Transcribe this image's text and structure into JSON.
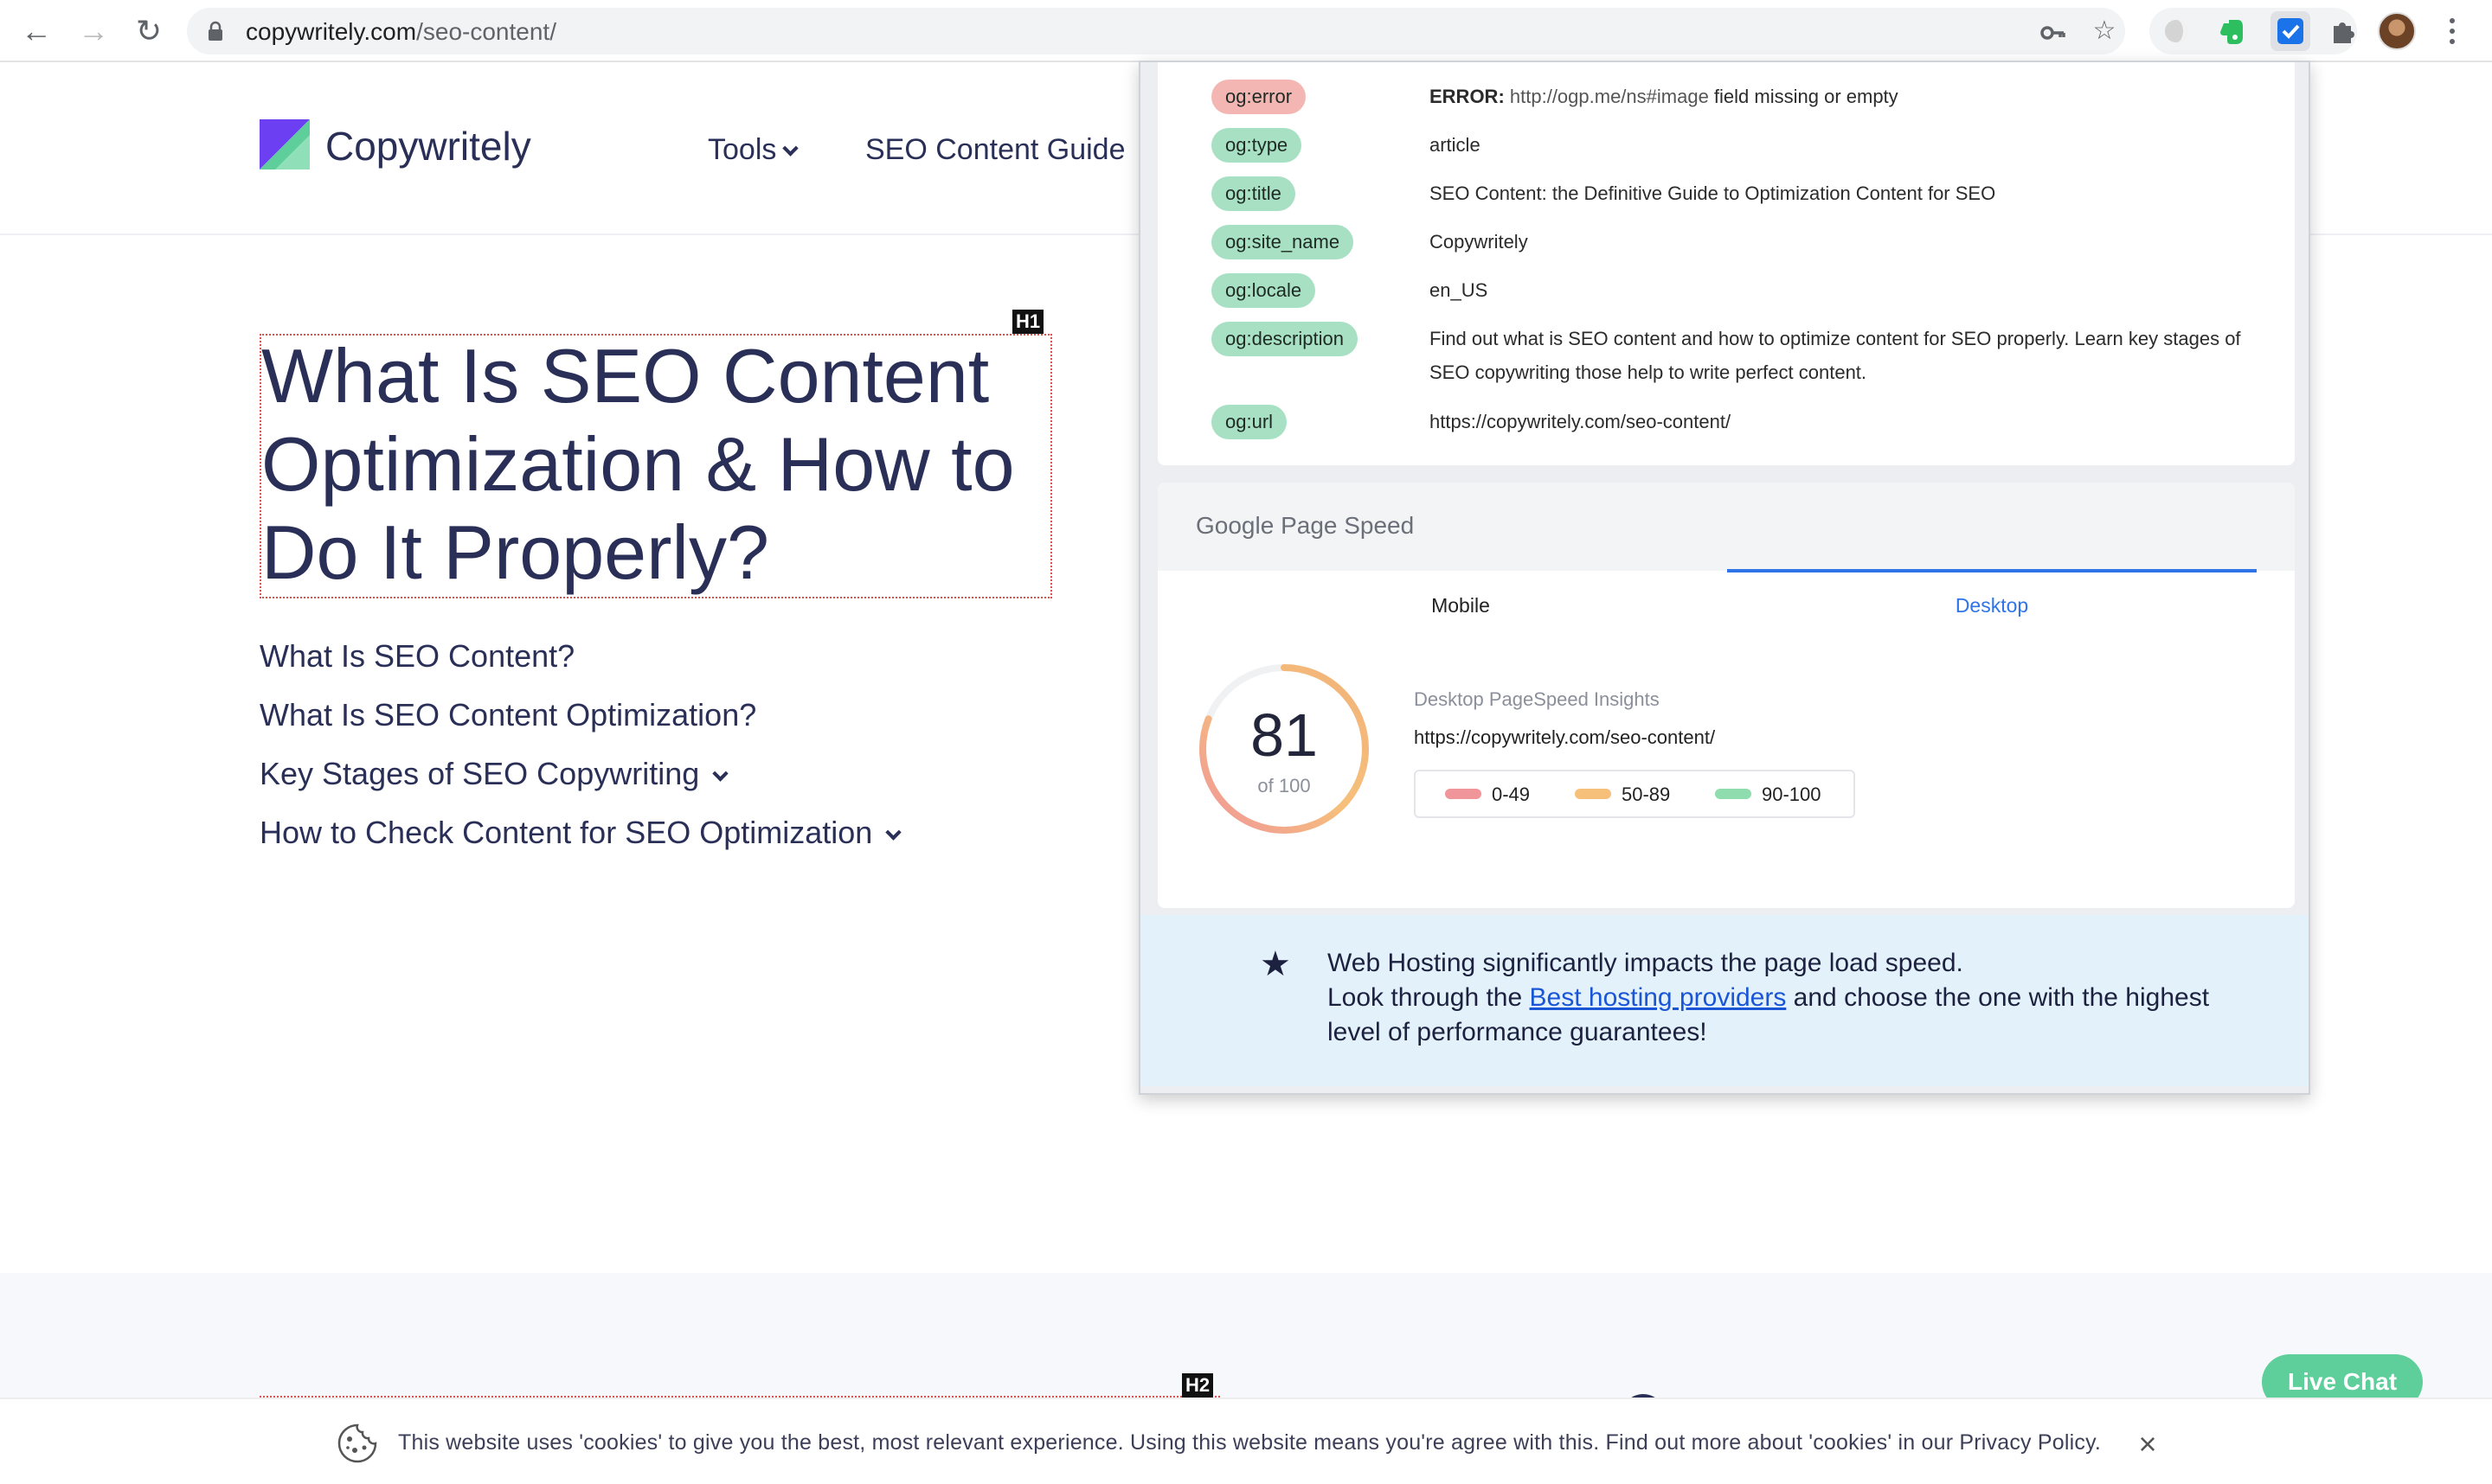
{
  "browser": {
    "url_domain": "copywritely.com",
    "url_path": "/seo-content/",
    "icons": [
      "back-arrow-icon",
      "forward-arrow-icon",
      "reload-icon",
      "lock-icon",
      "key-icon",
      "star-icon",
      "extensions-puzzle-icon",
      "menu-kebab-icon"
    ]
  },
  "site": {
    "logo_text": "Copywritely",
    "nav": {
      "tools": "Tools",
      "seo_guide": "SEO Content Guide"
    }
  },
  "main": {
    "h1_tag": "H1",
    "h2_tag": "H2",
    "h1": "What Is SEO Content Optimization & How to Do It Properly?",
    "toc": [
      {
        "label": "What Is SEO Content?"
      },
      {
        "label": "What Is SEO Content Optimization?"
      },
      {
        "label": "Key Stages of SEO Copywriting"
      },
      {
        "label": "How to Check Content for SEO Optimization"
      }
    ],
    "live_chat": "Live Chat"
  },
  "cookie": {
    "text": "This website uses 'cookies' to give you the best, most relevant experience. Using this website means you're agree with this. Find out more about 'cookies' in our Privacy Policy.",
    "close": "×"
  },
  "popup": {
    "og_rows": [
      {
        "tag": "og:error",
        "status": "error",
        "value_strong": "ERROR:",
        "value_mid": " http://ogp.me/ns#image",
        "value_tail": " field missing or empty"
      },
      {
        "tag": "og:type",
        "status": "ok",
        "value": "article"
      },
      {
        "tag": "og:title",
        "status": "ok",
        "value": "SEO Content: the Definitive Guide to Optimization Content for SEO"
      },
      {
        "tag": "og:site_name",
        "status": "ok",
        "value": "Copywritely"
      },
      {
        "tag": "og:locale",
        "status": "ok",
        "value": "en_US"
      },
      {
        "tag": "og:description",
        "status": "ok",
        "value": "Find out what is SEO content and how to optimize content for SEO properly. Learn key stages of SEO copywriting those help to write perfect content."
      },
      {
        "tag": "og:url",
        "status": "ok",
        "value": "https://copywritely.com/seo-content/"
      }
    ],
    "pagespeed": {
      "title": "Google Page Speed",
      "tabs": [
        "Mobile",
        "Desktop"
      ],
      "active_tab": "Desktop",
      "score": "81",
      "score_of": "of 100",
      "score_value": 81,
      "label": "Desktop PageSpeed Insights",
      "url": "https://copywritely.com/seo-content/",
      "legend": [
        {
          "range": "0-49",
          "color": "#f0959a"
        },
        {
          "range": "50-89",
          "color": "#f6c07a"
        },
        {
          "range": "90-100",
          "color": "#8fdcae"
        }
      ]
    },
    "hosting": {
      "line1": "Web Hosting significantly impacts the page load speed.",
      "pre_link": "Look through the ",
      "link": "Best hosting providers",
      "post_link": " and choose the one with the highest level of performance guarantees!"
    }
  },
  "colors": {
    "brand_navy": "#2a2f57",
    "accent_green": "#5ecf9a",
    "link_blue": "#2f74e8"
  }
}
